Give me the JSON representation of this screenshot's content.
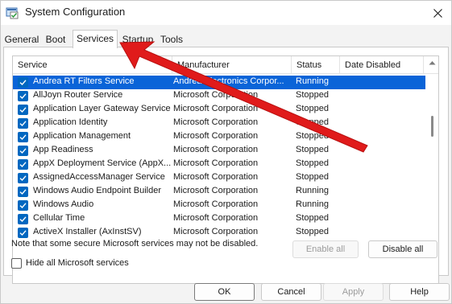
{
  "window": {
    "title": "System Configuration"
  },
  "tabs": [
    {
      "label": "General",
      "active": false
    },
    {
      "label": "Boot",
      "active": false
    },
    {
      "label": "Services",
      "active": true
    },
    {
      "label": "Startup",
      "active": false
    },
    {
      "label": "Tools",
      "active": false
    }
  ],
  "columns": {
    "service": "Service",
    "manufacturer": "Manufacturer",
    "status": "Status",
    "date_disabled": "Date Disabled"
  },
  "services": [
    {
      "name": "Andrea RT Filters Service",
      "manufacturer": "Andrea Electronics Corpor...",
      "status": "Running",
      "checked": true,
      "selected": true
    },
    {
      "name": "AllJoyn Router Service",
      "manufacturer": "Microsoft Corporation",
      "status": "Stopped",
      "checked": true
    },
    {
      "name": "Application Layer Gateway Service",
      "manufacturer": "Microsoft Corporation",
      "status": "Stopped",
      "checked": true
    },
    {
      "name": "Application Identity",
      "manufacturer": "Microsoft Corporation",
      "status": "Stopped",
      "checked": true
    },
    {
      "name": "Application Management",
      "manufacturer": "Microsoft Corporation",
      "status": "Stopped",
      "checked": true
    },
    {
      "name": "App Readiness",
      "manufacturer": "Microsoft Corporation",
      "status": "Stopped",
      "checked": true
    },
    {
      "name": "AppX Deployment Service (AppX...",
      "manufacturer": "Microsoft Corporation",
      "status": "Stopped",
      "checked": true
    },
    {
      "name": "AssignedAccessManager Service",
      "manufacturer": "Microsoft Corporation",
      "status": "Stopped",
      "checked": true
    },
    {
      "name": "Windows Audio Endpoint Builder",
      "manufacturer": "Microsoft Corporation",
      "status": "Running",
      "checked": true
    },
    {
      "name": "Windows Audio",
      "manufacturer": "Microsoft Corporation",
      "status": "Running",
      "checked": true
    },
    {
      "name": "Cellular Time",
      "manufacturer": "Microsoft Corporation",
      "status": "Stopped",
      "checked": true
    },
    {
      "name": "ActiveX Installer (AxInstSV)",
      "manufacturer": "Microsoft Corporation",
      "status": "Stopped",
      "checked": true
    }
  ],
  "note": "Note that some secure Microsoft services may not be disabled.",
  "hide_ms": {
    "label": "Hide all Microsoft services",
    "checked": false
  },
  "buttons": {
    "enable_all": "Enable all",
    "disable_all": "Disable all",
    "ok": "OK",
    "cancel": "Cancel",
    "apply": "Apply",
    "help": "Help"
  },
  "colors": {
    "selection": "#0a64d8",
    "checkbox": "#0067c0",
    "annotation_arrow": "#e01b1b"
  }
}
